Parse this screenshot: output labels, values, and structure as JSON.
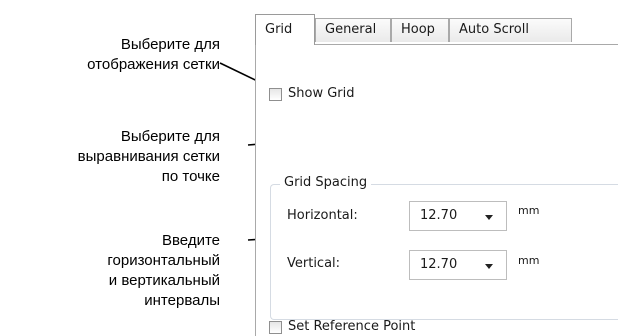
{
  "callouts": {
    "show_grid": [
      "Выберите для",
      "отображения сетки"
    ],
    "align": [
      "Выберите для",
      "выравнивания сетки",
      "по точке"
    ],
    "spacing": [
      "Введите",
      "горизонтальный",
      "и вертикальный",
      "интервалы"
    ]
  },
  "tabs": [
    "Grid",
    "General",
    "Hoop",
    "Auto Scroll"
  ],
  "show_grid_label": "Show Grid",
  "grid_spacing": {
    "title": "Grid Spacing",
    "horizontal_label": "Horizontal:",
    "horizontal_value": "12.70",
    "vertical_label": "Vertical:",
    "vertical_value": "12.70",
    "unit": "mm"
  },
  "set_reference_point_label": "Set Reference Point",
  "colors": {
    "text": "#1a1a1a",
    "border": "#a9a9a9",
    "group_border": "#d5dbe3",
    "arrow": "#000000"
  }
}
